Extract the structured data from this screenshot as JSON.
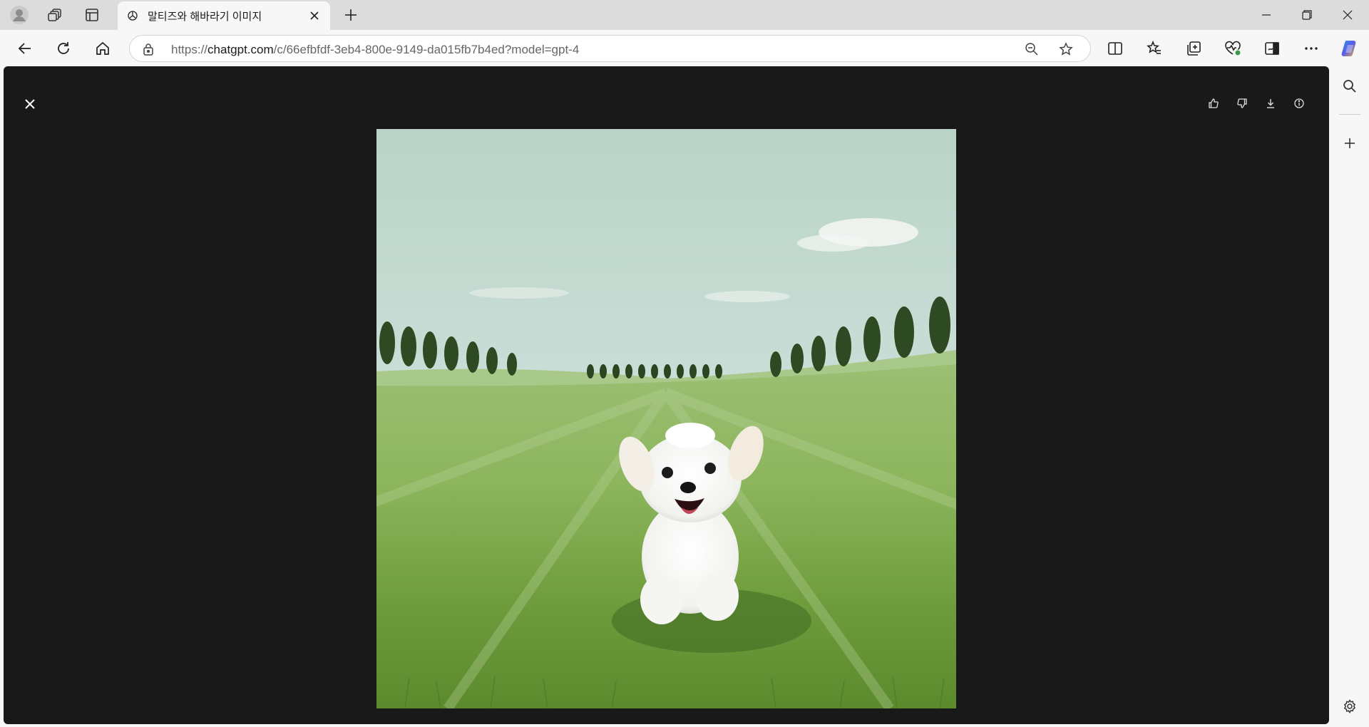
{
  "browser": {
    "tab": {
      "title": "말티즈와 해바라기 이미지"
    },
    "address": {
      "url_prefix": "https://",
      "url_host": "chatgpt.com",
      "url_path": "/c/66efbfdf-3eb4-800e-9149-da015fb7b4ed?model=gpt-4"
    },
    "icons": {
      "profile": "profile-icon",
      "workspaces": "workspaces-icon",
      "tab_actions": "tab-actions-icon",
      "back": "back-arrow-icon",
      "refresh": "refresh-icon",
      "home": "home-icon",
      "zoom": "zoom-out-icon",
      "favorite": "star-icon",
      "split_screen": "split-screen-icon",
      "favorites": "favorites-icon",
      "collections": "collections-icon",
      "browser_essentials": "browser-essentials-icon",
      "sidebar_toggle": "sidebar-toggle-icon",
      "more": "more-icon",
      "copilot": "copilot-icon"
    },
    "sidebar": {
      "icons": [
        "search-icon",
        "add-icon",
        "settings-icon"
      ]
    }
  },
  "viewer": {
    "image_alt": "Maltese puppy running on grass field",
    "actions": [
      "thumbs-up-icon",
      "thumbs-down-icon",
      "download-icon",
      "info-icon"
    ],
    "colors": {
      "background": "#191919"
    }
  }
}
